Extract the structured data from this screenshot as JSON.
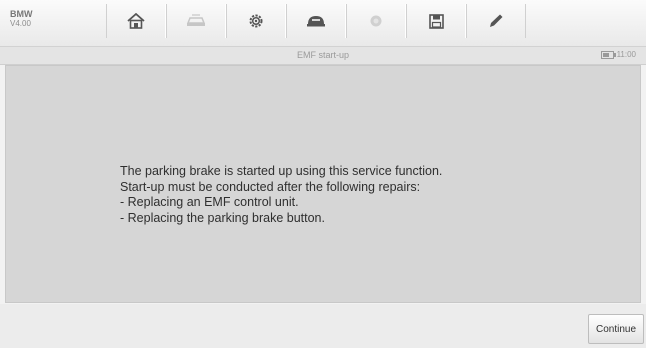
{
  "header": {
    "vehicle_make": "BMW",
    "vehicle_version": "V4.00"
  },
  "toolbar": {
    "buttons": [
      {
        "icon": "home-icon",
        "enabled": true
      },
      {
        "icon": "vehicle-swap-icon",
        "enabled": false
      },
      {
        "icon": "settings-icon",
        "enabled": true
      },
      {
        "icon": "vci-connection-icon",
        "enabled": true
      },
      {
        "icon": "record-icon",
        "enabled": false
      },
      {
        "icon": "save-icon",
        "enabled": true
      },
      {
        "icon": "edit-pen-icon",
        "enabled": true
      }
    ]
  },
  "titlebar": {
    "title": "EMF start-up",
    "status_time": "11:00"
  },
  "main": {
    "message_lines": [
      "The parking brake is started up using this service function.",
      "Start-up must be conducted after the following repairs:",
      "- Replacing an EMF control unit.",
      "- Replacing the parking brake button."
    ]
  },
  "footer": {
    "continue_label": "Continue"
  },
  "colors": {
    "toolbar_background": "#f2f2f2",
    "content_background": "#d6d6d6",
    "text": "#2f2f2f",
    "disabled_icon": "#c6c6c6",
    "enabled_icon": "#555555"
  }
}
